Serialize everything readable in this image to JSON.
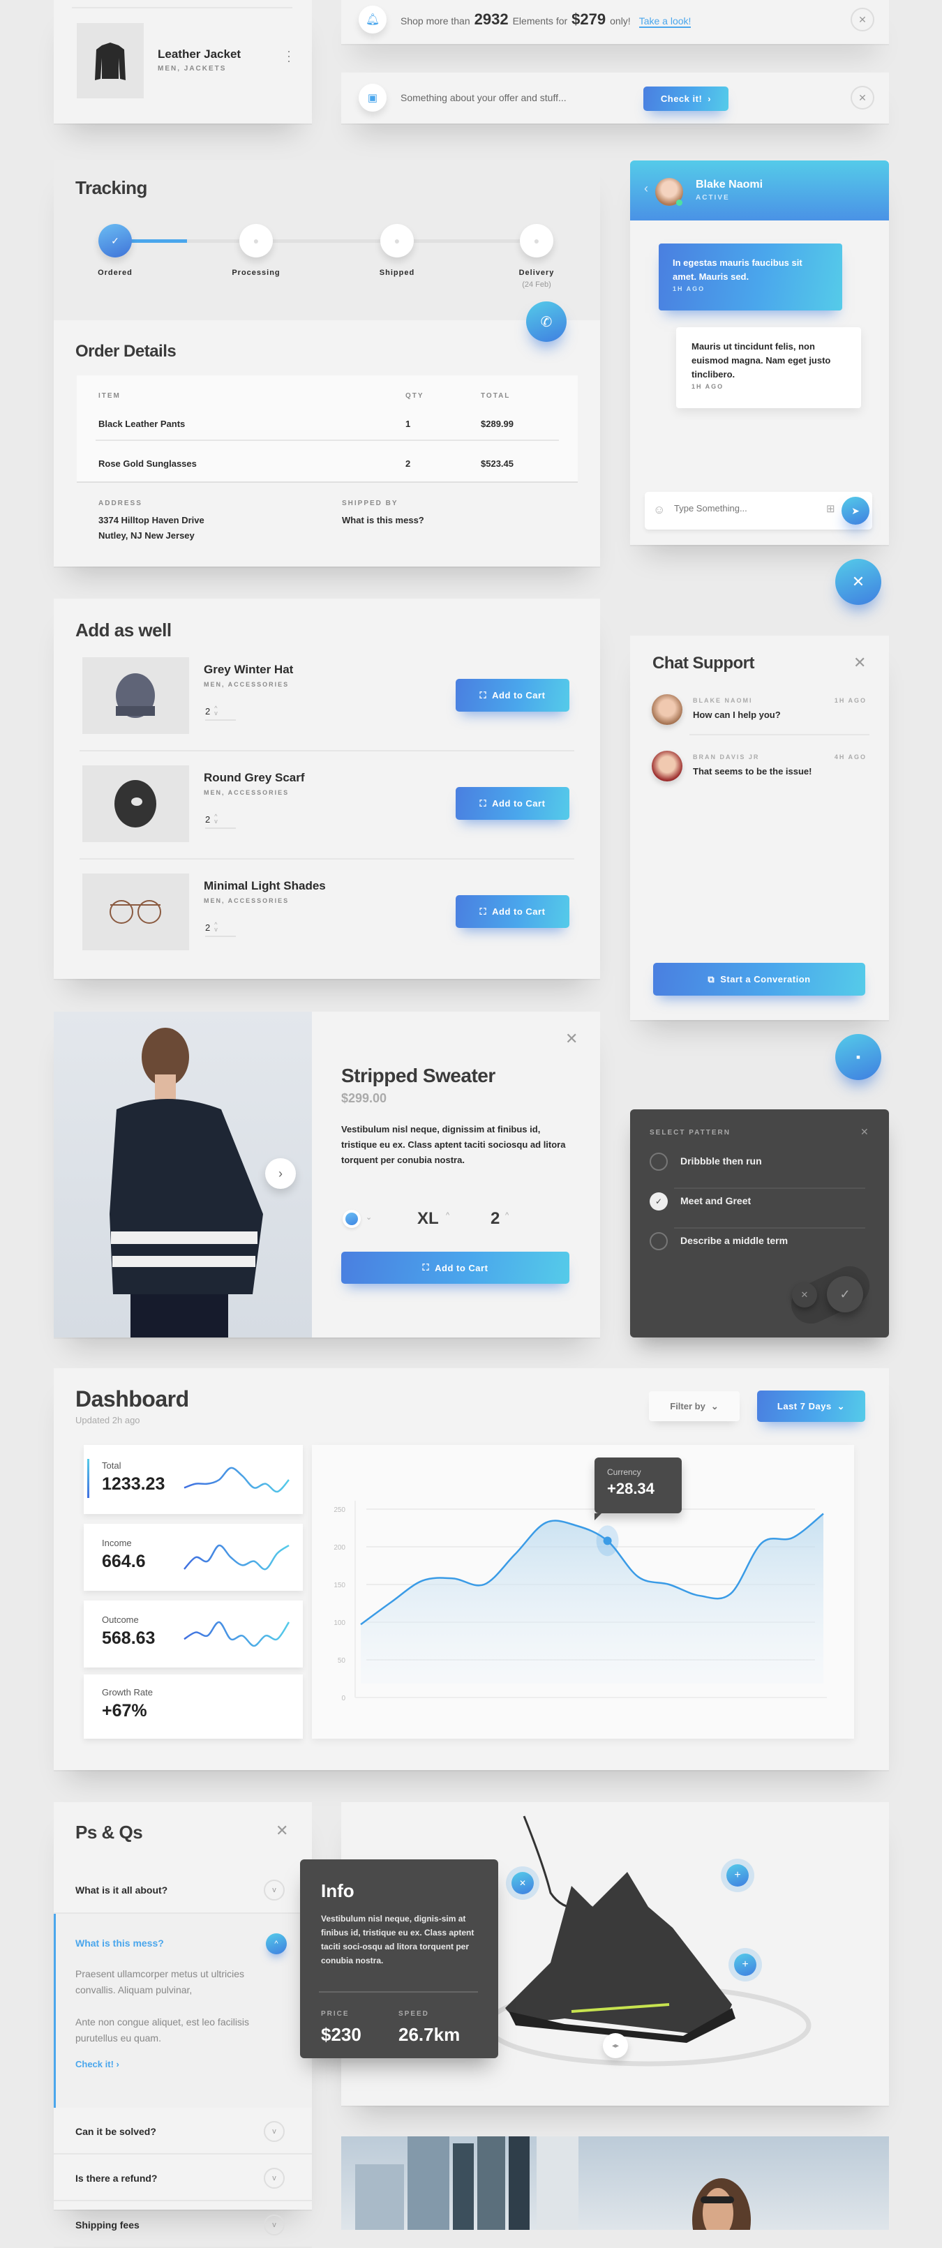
{
  "colors": {
    "accent": "#4aa6ec",
    "accent_dark": "#3f7fe0",
    "dark_panel": "#464646",
    "card": "#f3f3f3",
    "bg": "#ebebeb"
  },
  "product_card": {
    "title": "Leather Jacket",
    "category": "MEN, JACKETS",
    "menu_icon": "kebab-icon"
  },
  "notifications": [
    {
      "icon": "bell-icon",
      "text_pre": "Shop more than",
      "count": "2932",
      "text_mid": "Elements for",
      "price": "$279",
      "text_post": "only!",
      "link": "Take a look!"
    },
    {
      "icon": "chat-icon",
      "text": "Something about your offer and stuff...",
      "button": "Check it!"
    }
  ],
  "tracking": {
    "title": "Tracking",
    "progress": 0.17,
    "steps": [
      {
        "label": "Ordered",
        "done": true
      },
      {
        "label": "Processing",
        "done": false
      },
      {
        "label": "Shipped",
        "done": false
      },
      {
        "label": "Delivery",
        "sub": "(24 Feb)",
        "done": false
      }
    ]
  },
  "order": {
    "title": "Order Details",
    "headers": [
      "ITEM",
      "QTY",
      "TOTAL"
    ],
    "rows": [
      [
        "Black Leather Pants",
        "1",
        "$289.99"
      ],
      [
        "Rose Gold Sunglasses",
        "2",
        "$523.45"
      ]
    ],
    "address_label": "ADDRESS",
    "address": [
      "3374 Hilltop Haven Drive",
      "Nutley, NJ New Jersey"
    ],
    "shipped_label": "SHIPPED BY",
    "shipped": "What is this mess?"
  },
  "chat": {
    "name": "Blake Naomi",
    "status": "ACTIVE",
    "messages": [
      {
        "text": "In egestas mauris faucibus sit amet. Mauris sed.",
        "time": "1H AGO",
        "mine": true
      },
      {
        "text": "Mauris ut tincidunt felis, non euismod magna. Nam eget justo tinclibero.",
        "time": "1H AGO",
        "mine": false
      }
    ],
    "placeholder": "Type Something..."
  },
  "add_as_well": {
    "title": "Add as well",
    "button": "Add to Cart",
    "items": [
      {
        "name": "Grey Winter Hat",
        "category": "MEN, ACCESSORIES",
        "qty": "2"
      },
      {
        "name": "Round Grey Scarf",
        "category": "MEN, ACCESSORIES",
        "qty": "2"
      },
      {
        "name": "Minimal Light Shades",
        "category": "MEN, ACCESSORIES",
        "qty": "2"
      }
    ]
  },
  "support": {
    "title": "Chat Support",
    "button": "Start a Converation",
    "threads": [
      {
        "name": "BLAKE NAOMI",
        "time": "1H AGO",
        "text": "How can I help you?"
      },
      {
        "name": "BRAN DAVIS JR",
        "time": "4H AGO",
        "text": "That seems to be the issue!"
      }
    ]
  },
  "sweater": {
    "title": "Stripped Sweater",
    "price": "$299.00",
    "description": "Vestibulum nisl neque, dignissim at finibus id, tristique eu ex. Class aptent taciti sociosqu ad litora torquent per conubia nostra.",
    "size": "XL",
    "qty": "2",
    "button": "Add to Cart",
    "color": "#4aa6ec"
  },
  "pattern": {
    "title": "SELECT PATTERN",
    "options": [
      {
        "label": "Dribbble then run",
        "checked": false
      },
      {
        "label": "Meet and Greet",
        "checked": true
      },
      {
        "label": "Describe a middle term",
        "checked": false
      }
    ]
  },
  "dashboard": {
    "title": "Dashboard",
    "updated": "Updated 2h ago",
    "filter": "Filter by",
    "range": "Last 7 Days",
    "stats": [
      {
        "label": "Total",
        "value": "1233.23",
        "spark": [
          3,
          4,
          4,
          5,
          8,
          6,
          3,
          4,
          2,
          5
        ]
      },
      {
        "label": "Income",
        "value": "664.6",
        "spark": [
          2,
          5,
          4,
          8,
          5,
          3,
          4,
          2,
          6,
          8
        ]
      },
      {
        "label": "Outcome",
        "value": "568.63",
        "spark": [
          3,
          5,
          4,
          8,
          3,
          4,
          1,
          4,
          3,
          8
        ]
      },
      {
        "label": "Growth Rate",
        "value": "+67%"
      }
    ],
    "tooltip": {
      "label": "Currency",
      "value": "+28.34"
    }
  },
  "chart_data": {
    "type": "area",
    "ylim": [
      0,
      250
    ],
    "yticks": [
      "0",
      "50",
      "100",
      "150",
      "200",
      "250"
    ],
    "grid": true,
    "values": [
      97,
      127,
      155,
      158,
      150,
      190,
      232,
      228,
      208,
      160,
      150,
      135,
      138,
      205,
      212,
      244
    ],
    "highlight_index": 8
  },
  "faq": {
    "title": "Ps & Qs",
    "items": [
      {
        "q": "What is it all about?",
        "open": false
      },
      {
        "q": "What is this mess?",
        "open": true,
        "answer": "Praesent ullamcorper metus ut ultricies convallis. Aliquam pulvinar,",
        "answer2": "Ante non congue aliquet, est leo facilisis purutellus eu quam.",
        "link": "Check it!"
      },
      {
        "q": "Can it be solved?",
        "open": false
      },
      {
        "q": "Is there a refund?",
        "open": false
      },
      {
        "q": "Shipping fees",
        "open": false
      }
    ]
  },
  "info": {
    "title": "Info",
    "text": "Vestibulum nisl neque, dignis-sim at finibus id, tristique eu ex. Class aptent taciti soci-osqu ad litora torquent per conubia nostra.",
    "price_label": "PRICE",
    "price": "$230",
    "speed_label": "SPEED",
    "speed": "26.7km"
  }
}
